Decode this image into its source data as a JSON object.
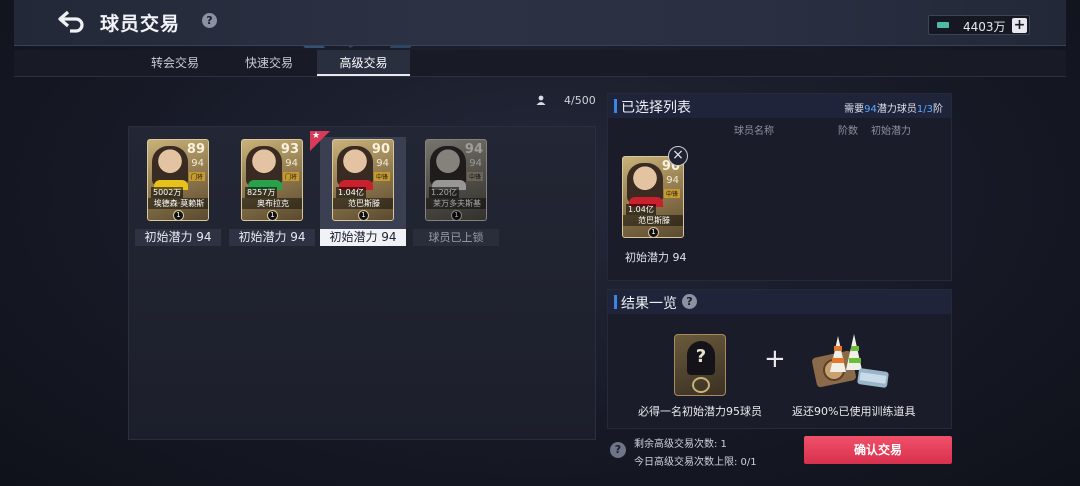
{
  "header": {
    "title": "球员交易",
    "help_glyph": "?",
    "currency_value": "4403万",
    "currency_add": "+"
  },
  "tabs": [
    {
      "label": "转会交易",
      "active": false
    },
    {
      "label": "快速交易",
      "active": false
    },
    {
      "label": "高级交易",
      "active": true
    }
  ],
  "roster_count": "4/500",
  "slots": [
    {
      "ovr": "89",
      "pot": "94",
      "pos": "门将",
      "price": "5002万",
      "name": "埃德森·莫赖斯",
      "level": "1",
      "label": "初始潜力 94",
      "selected": false,
      "locked": false,
      "jersey": "#e8c21c"
    },
    {
      "ovr": "93",
      "pot": "94",
      "pos": "门将",
      "price": "8257万",
      "name": "奥布拉克",
      "level": "1",
      "label": "初始潜力 94",
      "selected": false,
      "locked": false,
      "jersey": "#2aa04a"
    },
    {
      "ovr": "90",
      "pot": "94",
      "pos": "中锋",
      "price": "1.04亿",
      "name": "范巴斯滕",
      "level": "1",
      "label": "初始潜力 94",
      "selected": true,
      "locked": false,
      "jersey": "#c8202c",
      "star": "★"
    },
    {
      "ovr": "94",
      "pot": "94",
      "pos": "中锋",
      "price": "1.20亿",
      "name": "莱万多夫斯基",
      "level": "1",
      "label": "球员已上锁",
      "selected": false,
      "locked": true,
      "jersey": "#e8e8e8"
    }
  ],
  "selected_panel": {
    "title": "已选择列表",
    "need_prefix": "需要",
    "need_value": "94",
    "need_mid": "潜力球员",
    "need_count": "1/3",
    "need_suffix": "阶",
    "col_name": "球员名称",
    "col_stage": "阶数",
    "col_potential": "初始潜力",
    "card": {
      "ovr": "90",
      "pot": "94",
      "pos": "中锋",
      "price": "1.04亿",
      "name": "范巴斯滕",
      "level": "1"
    },
    "remove_glyph": "×",
    "card_potential": "初始潜力 94"
  },
  "result_panel": {
    "title": "结果一览",
    "help_glyph": "?",
    "mystery_glyph": "?",
    "plus": "+",
    "reward_label": "必得一名初始潜力95球员",
    "refund_label": "返还90%已使用训练道具"
  },
  "footer": {
    "help_glyph": "?",
    "remaining": "剩余高级交易次数: 1",
    "daily_limit": "今日高级交易次数上限: 0/1",
    "confirm_label": "确认交易"
  },
  "colors": {
    "accent_blue": "#3a86e0",
    "confirm_red": "#e0405c",
    "gold_card": "#c9b27a"
  }
}
